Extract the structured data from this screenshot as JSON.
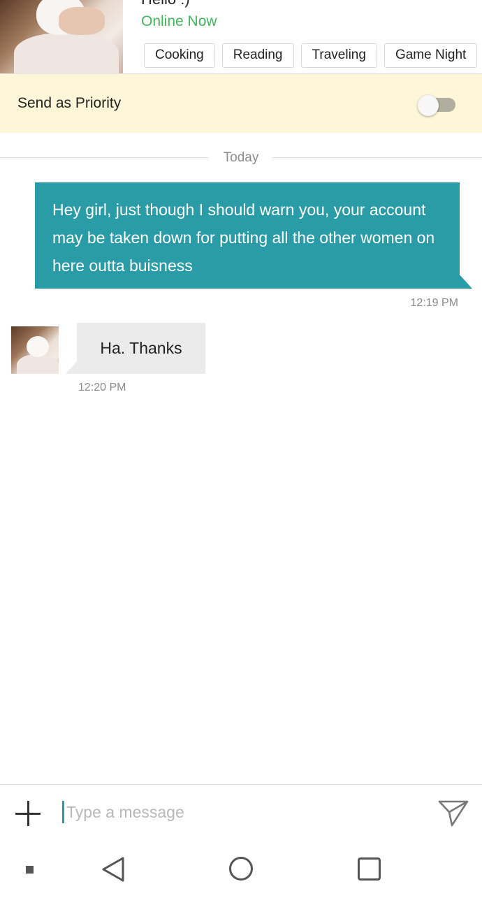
{
  "header": {
    "status_message": "Hello :)",
    "online_status": "Online Now",
    "interests": [
      "Cooking",
      "Reading",
      "Traveling",
      "Game Night"
    ]
  },
  "priority": {
    "label": "Send as Priority",
    "enabled": false
  },
  "conversation": {
    "date_divider": "Today",
    "messages": [
      {
        "direction": "outgoing",
        "text": "Hey girl, just though I should warn you, your account may be taken down for putting all the other women on here outta buisness",
        "time": "12:19 PM"
      },
      {
        "direction": "incoming",
        "text": "Ha. Thanks",
        "time": "12:20 PM"
      }
    ]
  },
  "composer": {
    "placeholder": "Type a message"
  },
  "icons": {
    "add": "plus-icon",
    "send": "send-icon",
    "nav": [
      "square-dot-icon",
      "back-icon",
      "home-icon",
      "recent-apps-icon"
    ]
  },
  "colors": {
    "accent": "#2a9ca7",
    "online": "#3fb85a",
    "priority_bg": "#fdf6d8",
    "incoming_bubble": "#ebebeb"
  }
}
